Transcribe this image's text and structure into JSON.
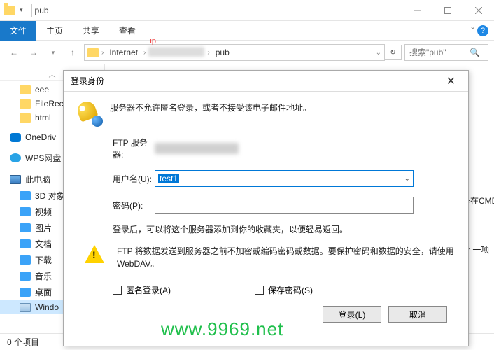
{
  "window": {
    "title": "pub"
  },
  "ribbon": {
    "file": "文件",
    "tabs": [
      "主页",
      "共享",
      "查看"
    ],
    "chevron": "ˇ"
  },
  "address": {
    "ip_tag": "ip",
    "crumbs": [
      "Internet",
      "pub"
    ],
    "refresh": "✓",
    "search_placeholder": "搜索\"pub\""
  },
  "sidebar": {
    "scroll_up": "︿",
    "quick": [
      "eee",
      "FileRec",
      "html"
    ],
    "cloud": [
      "OneDriv",
      "WPS网盘"
    ],
    "pc_label": "此电脑",
    "pc_items": [
      "3D 对象",
      "视频",
      "图片",
      "文档",
      "下载",
      "音乐",
      "桌面",
      "Windo"
    ]
  },
  "statusbar": {
    "text": "0 个项目"
  },
  "dialog": {
    "title": "登录身份",
    "message": "服务器不允许匿名登录，或者不接受该电子邮件地址。",
    "server_label": "FTP 服务器:",
    "user_label": "用户名(U):",
    "user_value": "test1",
    "pass_label": "密码(P):",
    "info": "登录后，可以将这个服务器添加到你的收藏夹，以便轻易返回。",
    "warn": "FTP 将数据发送到服务器之前不加密或编码密码或数据。要保护密码和数据的安全，请使用 WebDAV。",
    "anon": "匿名登录(A)",
    "save": "保存密码(S)",
    "login_btn": "登录(L)",
    "cancel_btn": "取消"
  },
  "bg": {
    "cmd": "是在CMD",
    "dir": "_dir 一项"
  },
  "watermark": "www.9969.net"
}
